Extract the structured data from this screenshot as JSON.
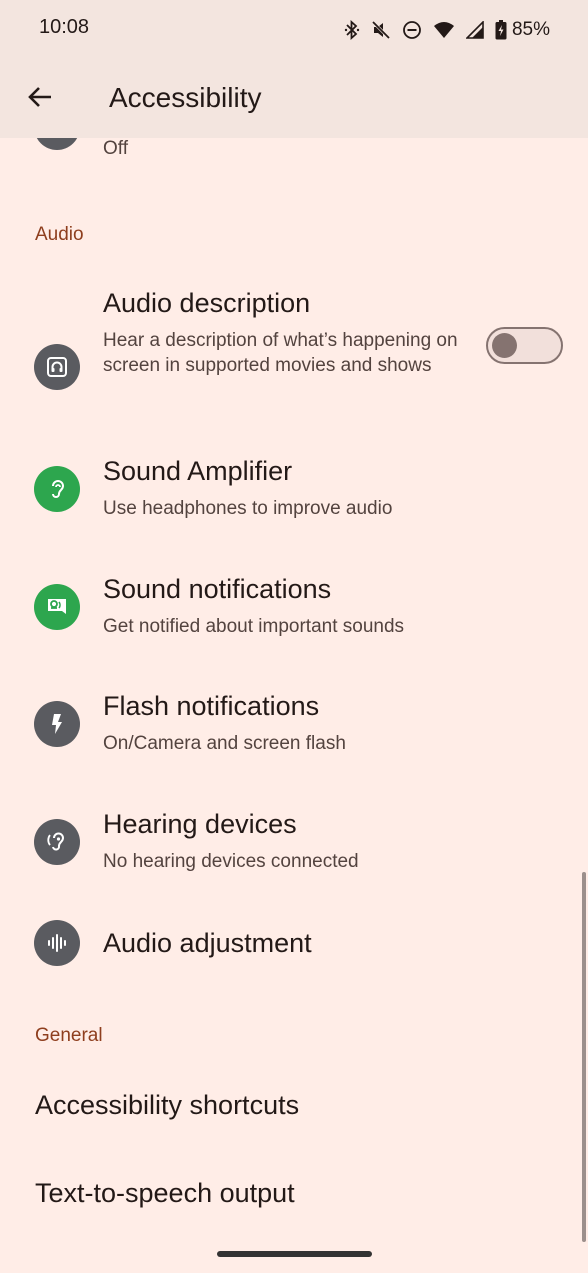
{
  "status_bar": {
    "time": "10:08",
    "battery": "85%",
    "icons": [
      "bluetooth-icon",
      "silent-mode-icon",
      "do-not-disturb-icon",
      "wifi-icon",
      "cell-signal-icon",
      "battery-charging-icon"
    ]
  },
  "app_bar": {
    "back_icon": "arrow-back-icon",
    "title": "Accessibility"
  },
  "partial_item": {
    "summary": "Off"
  },
  "sections": {
    "audio": {
      "header": "Audio",
      "items": [
        {
          "title": "Audio description",
          "summary": "Hear a description of what’s happening on screen in supported movies and shows",
          "icon": "audio-description-icon",
          "toggle": false
        },
        {
          "title": "Sound Amplifier",
          "summary": "Use headphones to improve audio",
          "icon": "ear-icon"
        },
        {
          "title": "Sound notifications",
          "summary": "Get notified about important sounds",
          "icon": "sound-notification-icon"
        },
        {
          "title": "Flash notifications",
          "summary": "On/Camera and screen flash",
          "icon": "flash-icon"
        },
        {
          "title": "Hearing devices",
          "summary": "No hearing devices connected",
          "icon": "hearing-device-icon"
        },
        {
          "title": "Audio adjustment",
          "summary": "",
          "icon": "audio-wave-icon"
        }
      ]
    },
    "general": {
      "header": "General",
      "items": [
        {
          "title": "Accessibility shortcuts"
        },
        {
          "title": "Text-to-speech output"
        }
      ]
    }
  },
  "colors": {
    "background": "#FFEDE7",
    "app_bar": "#F3E5DF",
    "section_header": "#8E3E1E",
    "icon_grey": "#5A5B60",
    "icon_green": "#2DA64E"
  }
}
